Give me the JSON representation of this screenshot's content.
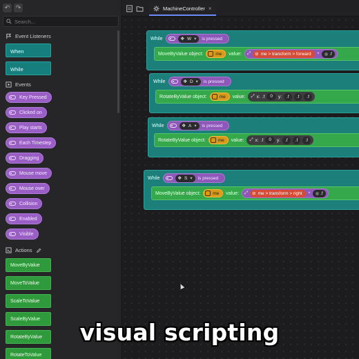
{
  "sidebar": {
    "search_placeholder": "Search...",
    "event_listeners": {
      "title": "Event Listeners",
      "items": [
        "When",
        "While"
      ]
    },
    "events": {
      "title": "Events",
      "items": [
        "Key Pressed",
        "Clicked on",
        "Play starts",
        "Each Timestep",
        "Dragging",
        "Mouse move",
        "Mouse over",
        "Collision",
        "Enabled",
        "Visible"
      ]
    },
    "actions": {
      "title": "Actions",
      "items": [
        "MoveByValue",
        "MoveToValue",
        "ScaleToValue",
        "ScaleByValue",
        "RotateByValue",
        "RotateToValue"
      ]
    }
  },
  "tab": {
    "label": "MachineController",
    "close": "×"
  },
  "blocks": [
    {
      "while": "While",
      "key": "W",
      "pressed": "is pressed",
      "action": "MoveByValue object:",
      "object": "me",
      "value_label": "value:",
      "path": "me > transform > forward",
      "op": "*",
      "f": ".f"
    },
    {
      "while": "While",
      "key": "D",
      "pressed": "is pressed",
      "action": "RotateByValue object:",
      "object": "me",
      "value_label": "value:",
      "x_label": "x:",
      "x_f": ".f",
      "x_val": "0",
      "y_label": "y:",
      "f": ".f"
    },
    {
      "while": "While",
      "key": "A",
      "pressed": "is pressed",
      "action": "RotateByValue object:",
      "object": "me",
      "value_label": "value:",
      "x_label": "x:",
      "x_f": ".f",
      "x_val": "0",
      "y_label": "y:",
      "f": ".f"
    },
    {
      "while": "While",
      "key": "S",
      "pressed": "is pressed",
      "action": "MoveByValue object:",
      "object": "me",
      "value_label": "value:",
      "path": "me > transform > right",
      "op": "*",
      "f": ".f"
    }
  ],
  "caption": "visual scripting",
  "colors": {
    "teal": "#1d7f7a",
    "purple": "#8d58b8",
    "green": "#34a84a",
    "orange": "#d99a19",
    "red": "#d64b35",
    "tab_accent": "#6e8cff"
  }
}
